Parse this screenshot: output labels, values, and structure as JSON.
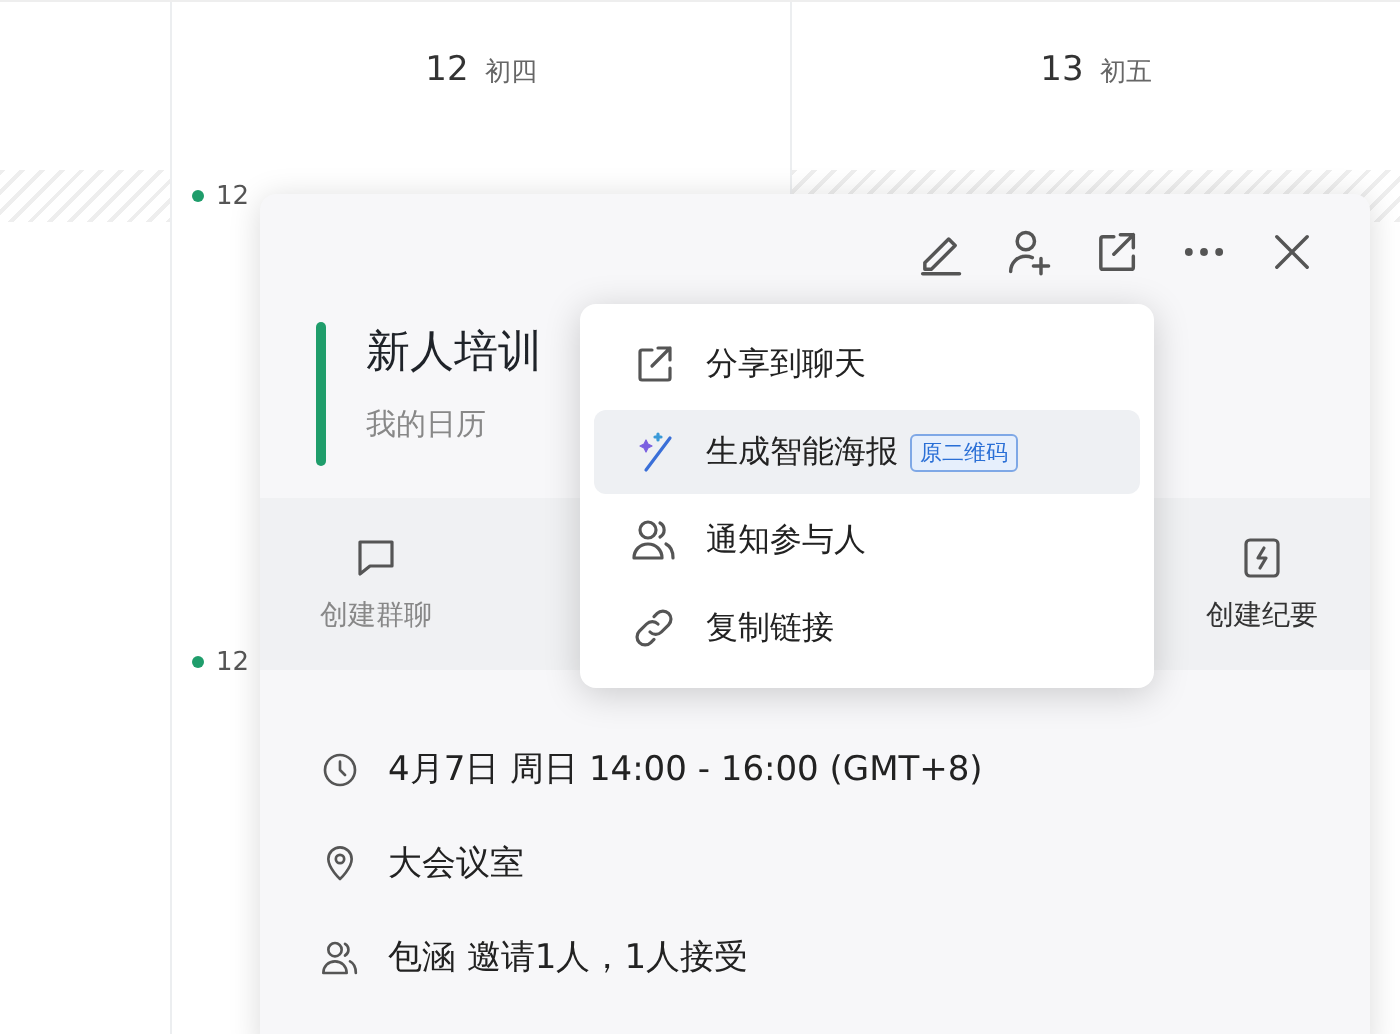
{
  "calendar": {
    "days": [
      {
        "date": "12",
        "lunar": "初四"
      },
      {
        "date": "13",
        "lunar": "初五"
      }
    ],
    "events": [
      {
        "time": "12",
        "color": "#1f9d6b"
      },
      {
        "time": "12",
        "color": "#1f9d6b"
      }
    ]
  },
  "event_card": {
    "title": "新人培训",
    "calendar": "我的日历",
    "color": "#1f9d6b",
    "actions": [
      {
        "label": "创建群聊",
        "kind": "chat"
      },
      {
        "label": "创建纪要",
        "kind": "notes"
      }
    ],
    "details": [
      {
        "kind": "time",
        "text": "4月7日 周日 14:00 - 16:00 (GMT+8)"
      },
      {
        "kind": "location",
        "text": "大会议室"
      },
      {
        "kind": "people",
        "text": "包涵 邀请1人，1人接受"
      }
    ]
  },
  "share_menu": {
    "items": [
      {
        "kind": "share",
        "label": "分享到聊天",
        "selected": false
      },
      {
        "kind": "poster",
        "label": "生成智能海报",
        "badge": "原二维码",
        "selected": true
      },
      {
        "kind": "notify",
        "label": "通知参与人",
        "selected": false
      },
      {
        "kind": "link",
        "label": "复制链接",
        "selected": false
      }
    ]
  }
}
